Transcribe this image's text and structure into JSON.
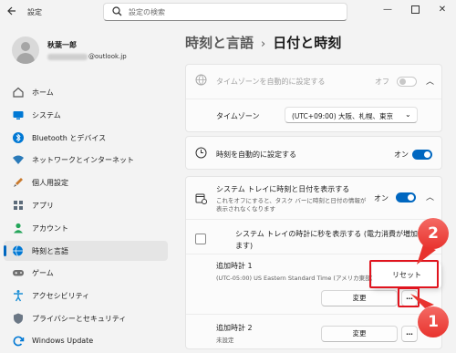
{
  "window": {
    "back_icon": "arrow-left-icon",
    "title": "設定",
    "controls": [
      "minimize-icon",
      "maximize-icon",
      "close-icon"
    ]
  },
  "search": {
    "placeholder": "設定の検索",
    "icon": "search-icon"
  },
  "user": {
    "name": "秋葉一郎",
    "email_suffix": "@outlook.jp"
  },
  "sidebar": {
    "items": [
      {
        "label": "ホーム",
        "icon": "home-icon",
        "color": "#555555"
      },
      {
        "label": "システム",
        "icon": "monitor-icon",
        "color": "#0078d4"
      },
      {
        "label": "Bluetooth とデバイス",
        "icon": "bluetooth-icon",
        "color": "#0078d4"
      },
      {
        "label": "ネットワークとインターネット",
        "icon": "wifi-icon",
        "color": "#2a7ab9"
      },
      {
        "label": "個人用設定",
        "icon": "brush-icon",
        "color": "#c97a2d"
      },
      {
        "label": "アプリ",
        "icon": "apps-icon",
        "color": "#5c6b7a"
      },
      {
        "label": "アカウント",
        "icon": "person-icon",
        "color": "#23a559"
      },
      {
        "label": "時刻と言語",
        "icon": "globe-clock-icon",
        "color": "#0078d4",
        "active": true
      },
      {
        "label": "ゲーム",
        "icon": "gamepad-icon",
        "color": "#707070"
      },
      {
        "label": "アクセシビリティ",
        "icon": "accessibility-icon",
        "color": "#1b8fd6"
      },
      {
        "label": "プライバシーとセキュリティ",
        "icon": "shield-icon",
        "color": "#6b7785"
      },
      {
        "label": "Windows Update",
        "icon": "update-icon",
        "color": "#0078d4"
      }
    ]
  },
  "page": {
    "breadcrumb_parent": "時刻と言語",
    "breadcrumb_separator": "›",
    "title": "日付と時刻"
  },
  "settings": {
    "auto_timezone": {
      "label": "タイムゾーンを自動的に設定する",
      "toggle_text": "オフ",
      "state": "off",
      "disabled": true
    },
    "timezone": {
      "label": "タイムゾーン",
      "value": "(UTC+09:00) 大阪、札幌、東京"
    },
    "auto_time": {
      "label": "時刻を自動的に設定する",
      "toggle_text": "オン",
      "state": "on"
    },
    "tray": {
      "label": "システム トレイに時刻と日付を表示する",
      "desc_line1": "これをオフにすると、タスク バーに時刻と日付の情報が",
      "desc_line2": "表示されなくなります",
      "toggle_text": "オン",
      "state": "on"
    },
    "seconds": {
      "label_line1": "システム トレイの時計に秒を表示する (電力消費が増加し",
      "label_line2": "ます)"
    },
    "clock1": {
      "label": "追加時計 1",
      "sub": "(UTC-05:00) US Eastern Standard Time (アメリカ東部)",
      "reset_label": "リセット",
      "change_label": "変更",
      "more_label": "…"
    },
    "clock2": {
      "label": "追加時計 2",
      "sub": "未設定",
      "change_label": "変更"
    }
  },
  "annotations": {
    "callout_1": "1",
    "callout_2": "2",
    "color": "#e0141e"
  }
}
